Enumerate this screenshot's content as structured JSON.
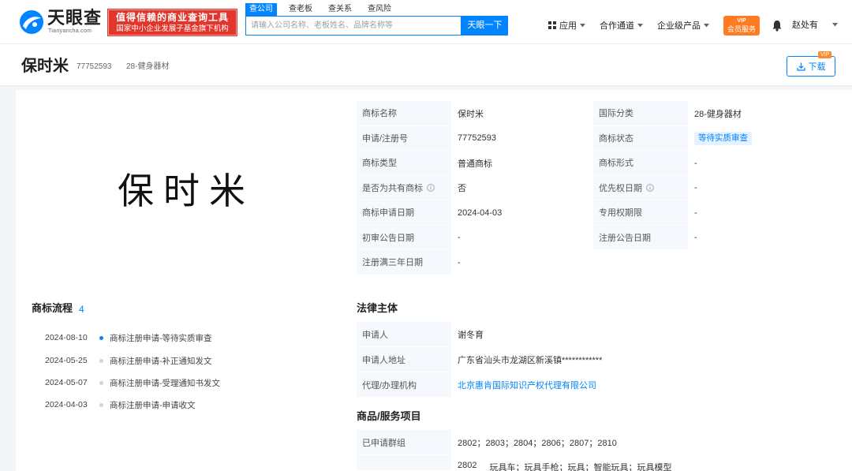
{
  "colors": {
    "accent": "#0084ff",
    "banner": "#e2352b",
    "vip": "#ff7b22",
    "status_bg": "#e6f2ff"
  },
  "header": {
    "logo_icon": "eye-swoosh-icon",
    "logo_text": "天眼查",
    "logo_sub": "Tianyancha.com",
    "banner_line1": "值得信赖的商业查询工具",
    "banner_line2": "国家中小企业发展子基金旗下机构",
    "search_tabs": [
      "查公司",
      "查老板",
      "查关系",
      "查风险"
    ],
    "active_tab_index": 0,
    "search_placeholder": "请输入公司名称、老板姓名、品牌名称等",
    "search_value": "",
    "search_button": "天眼一下",
    "nav": [
      {
        "label": "应用",
        "icon": "grid-icon"
      },
      {
        "label": "合作通道",
        "icon": "chevron-down-icon"
      },
      {
        "label": "企业级产品",
        "icon": "chevron-down-icon"
      }
    ],
    "vip_badge_top": "VIP",
    "vip_badge_label": "会员服务",
    "notification_icon": "bell-icon",
    "user_name": "赵处有"
  },
  "trademark_header": {
    "name": "保时米",
    "reg_no": "77752593",
    "class": "28-健身器材",
    "download_label": "下载",
    "download_badge": "VIP"
  },
  "mark_image": {
    "text": "保时米"
  },
  "details": {
    "rows": [
      {
        "l1": "商标名称",
        "v1": "保时米",
        "l2": "国际分类",
        "v2": "28-健身器材"
      },
      {
        "l1": "申请/注册号",
        "v1": "77752593",
        "l2": "商标状态",
        "v2": "等待实质审查"
      },
      {
        "l1": "商标类型",
        "v1": "普通商标",
        "l2": "商标形式",
        "v2": "-"
      },
      {
        "l1": "是否为共有商标",
        "v1": "否",
        "l2": "优先权日期",
        "v2": "-"
      },
      {
        "l1": "商标申请日期",
        "v1": "2024-04-03",
        "l2": "专用权期限",
        "v2": "-"
      },
      {
        "l1": "初审公告日期",
        "v1": "-",
        "l2": "注册公告日期",
        "v2": "-"
      },
      {
        "l1": "注册满三年日期",
        "v1": "-"
      }
    ]
  },
  "process": {
    "title": "商标流程",
    "count": "4",
    "items": [
      {
        "date": "2024-08-10",
        "status": "商标注册申请-等待实质审查",
        "current": true
      },
      {
        "date": "2024-05-25",
        "status": "商标注册申请-补正通知发文",
        "current": false
      },
      {
        "date": "2024-05-07",
        "status": "商标注册申请-受理通知书发文",
        "current": false
      },
      {
        "date": "2024-04-03",
        "status": "商标注册申请-申请收文",
        "current": false
      }
    ]
  },
  "legal": {
    "title": "法律主体",
    "rows": [
      {
        "label": "申请人",
        "value": "谢冬育"
      },
      {
        "label": "申请人地址",
        "value": "广东省汕头市龙湖区新溪镇************"
      },
      {
        "label": "代理/办理机构",
        "value": "北京惠肯国际知识产权代理有限公司"
      }
    ]
  },
  "goods": {
    "title": "商品/服务项目",
    "rows": [
      {
        "label": "已申请群组",
        "value": "2802；2803；2804；2806；2807；2810"
      },
      {
        "code": "2802",
        "value": "玩具车；玩具手枪；玩具；智能玩具；玩具模型"
      }
    ]
  }
}
